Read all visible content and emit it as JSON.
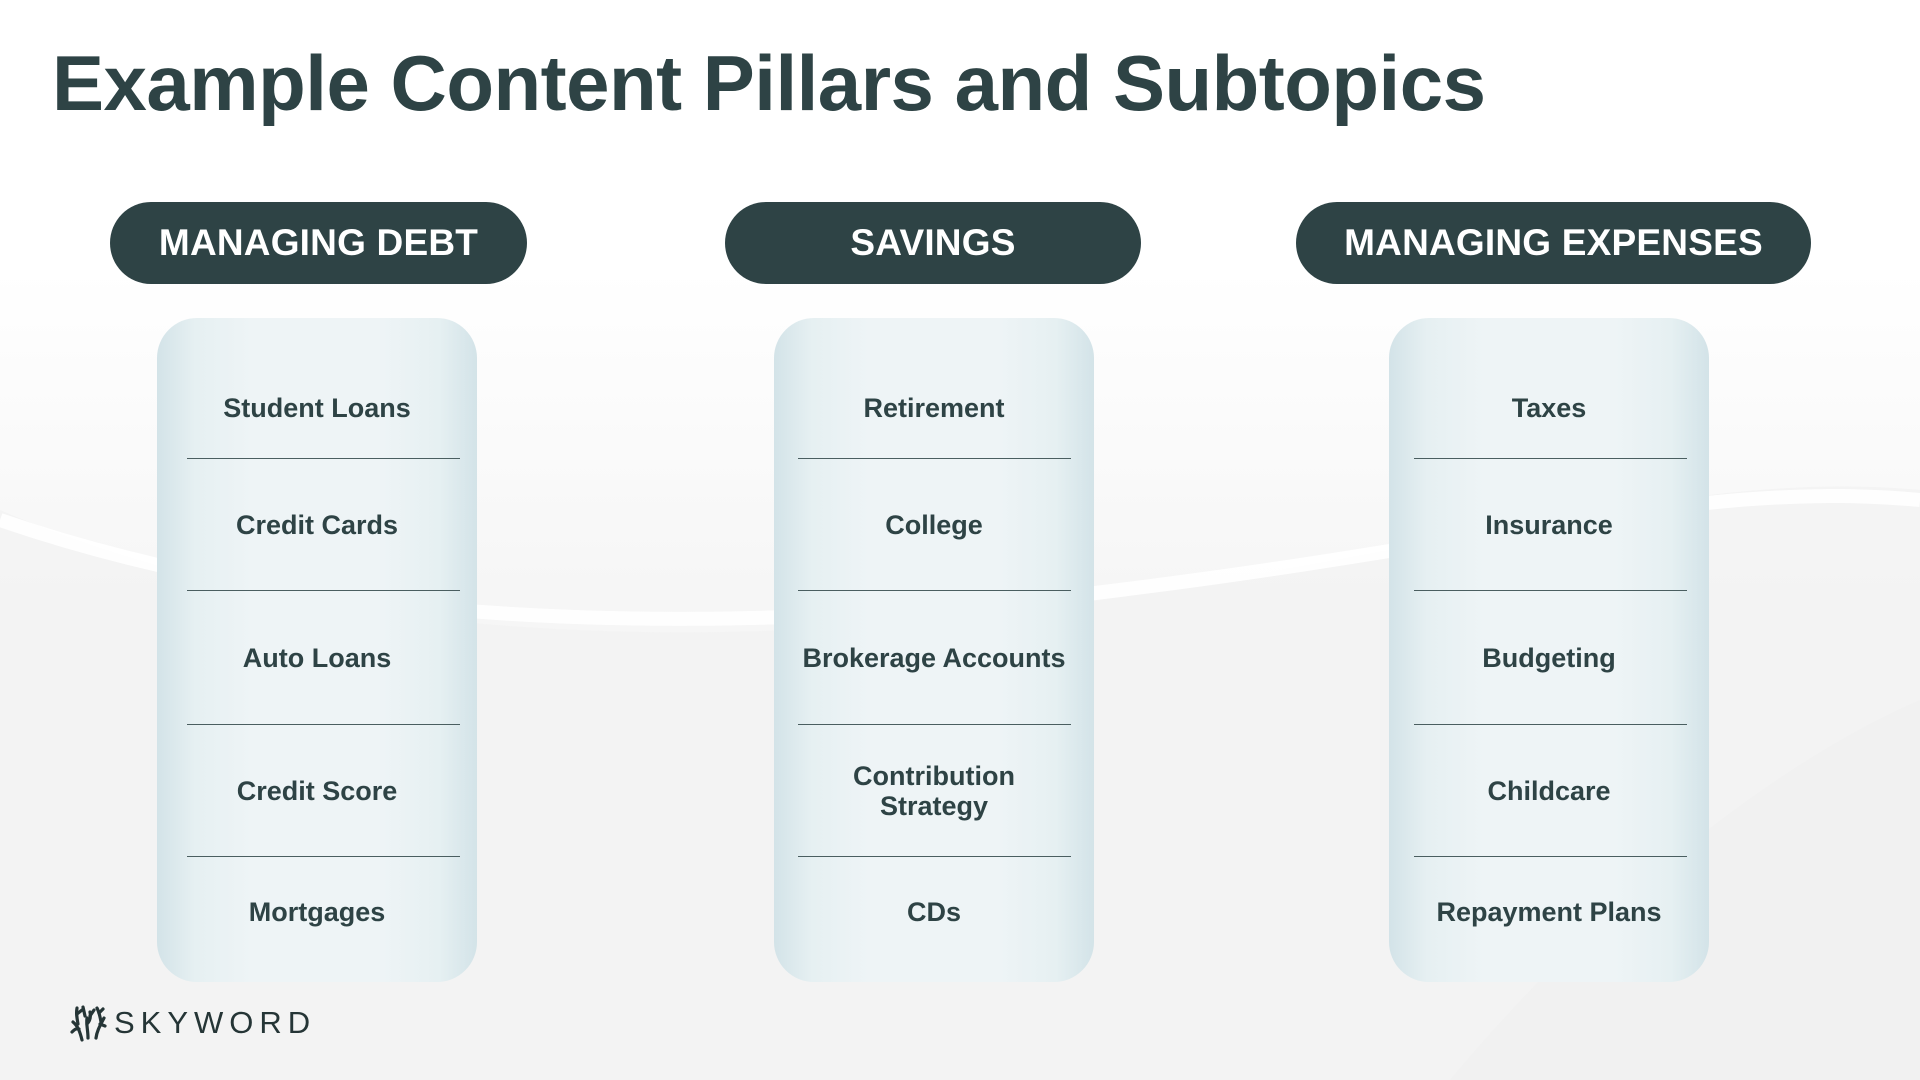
{
  "title": "Example Content Pillars and Subtopics",
  "pillars": [
    {
      "label": "MANAGING DEBT",
      "subtopics": [
        "Student Loans",
        "Credit Cards",
        "Auto Loans",
        "Credit Score",
        "Mortgages"
      ]
    },
    {
      "label": "SAVINGS",
      "subtopics": [
        "Retirement",
        "College",
        "Brokerage Accounts",
        "Contribution Strategy",
        "CDs"
      ]
    },
    {
      "label": "MANAGING EXPENSES",
      "subtopics": [
        "Taxes",
        "Insurance",
        "Budgeting",
        "Childcare",
        "Repayment Plans"
      ]
    }
  ],
  "logo": {
    "icon": "tree-branches-icon",
    "text": "SKYWORD"
  },
  "colors": {
    "primary": "#2e4345",
    "card": "#eef4f6",
    "pill_text": "#ffffff"
  }
}
